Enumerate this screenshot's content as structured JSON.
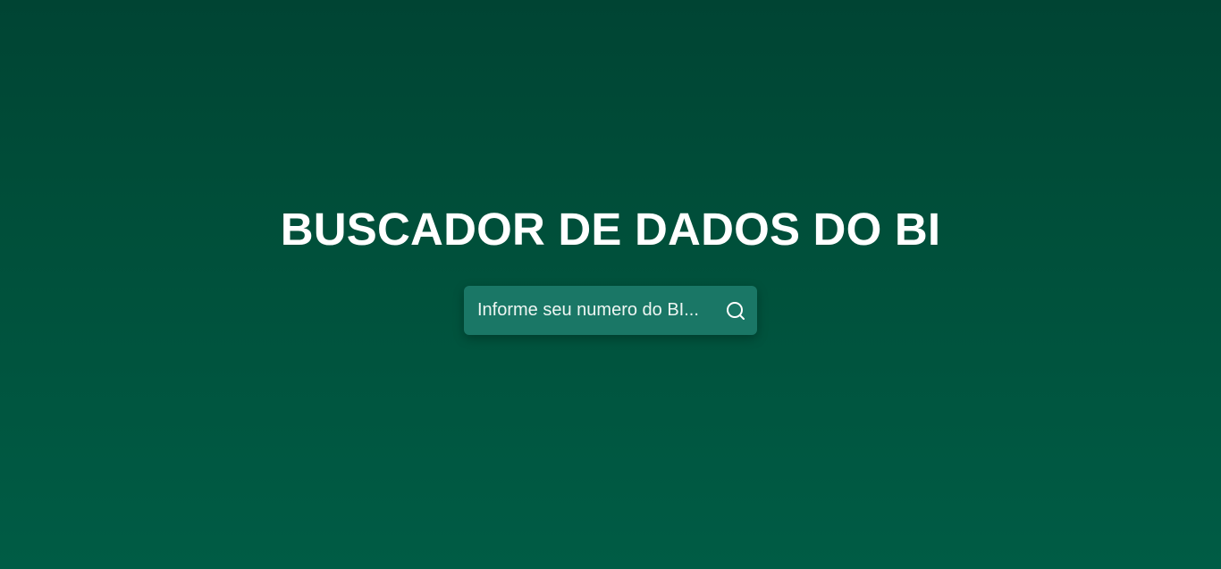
{
  "header": {
    "title": "BUSCADOR DE DADOS DO BI"
  },
  "search": {
    "placeholder": "Informe seu numero do BI...",
    "value": "",
    "icon": "search-icon"
  },
  "colors": {
    "background_top": "#004433",
    "background_bottom": "#005c45",
    "search_box": "#1a7766",
    "text": "#ffffff"
  }
}
